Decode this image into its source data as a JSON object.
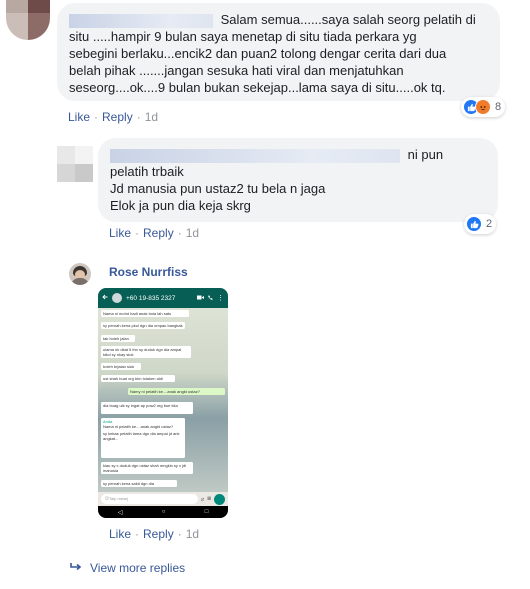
{
  "comments": [
    {
      "text_lines": [
        "Salam semua......saya salah seorg pelatih di",
        "situ .....hampir 9 bulan saya menetap di situ tiada perkara yg",
        "sebegini berlaku...encik2 dan puan2 tolong dengar cerita dari dua",
        "belah pihak .......jangan sesuka hati viral dan menjatuhkan",
        "seseorg....ok....9 bulan bukan sekejap...lama saya di situ.....ok tq."
      ],
      "reaction_count": "8",
      "like_label": "Like",
      "reply_label": "Reply",
      "time": "1d"
    },
    {
      "text_lines": [
        "ni pun",
        "pelatih trbaik",
        "Jd manusia pun ustaz2 tu bela n jaga",
        "Elok ja pun dia keja skrg"
      ],
      "reaction_count": "2",
      "like_label": "Like",
      "reply_label": "Reply",
      "time": "1d"
    },
    {
      "author": "Rose Nurrfiss",
      "like_label": "Like",
      "reply_label": "Reply",
      "time": "1d",
      "screenshot": {
        "contact": "+60 19-835 2327",
        "messages": [
          "Nama ni mohd hadi anak bola lah satu",
          "sy pernah kena pkul dgn dia ompau bangkak",
          "tak boleh jalan",
          "ulama nk dkat 5 thn sy duduk dgn dia ampai tdkd sy okay siuk",
          "boleh brjalan siuk",
          "ust shah buat org bkn tolaken aldi",
          "Namy ni pelatih ke....anak angkt ustaz?",
          "dia buag ulk sy ingat ap pow2 org bue kita",
          "Anda",
          "Nama ni pelatih ke....anak angkt ustaz?",
          "sy bekas pelatih lama dgn dia ampai jd ank angkat...",
          "klau sy x duduk dgn ustaz shah mngkin sy x jdi manusia",
          "sy pernah kena sakit dgn dia"
        ],
        "input_placeholder": "Taip mesej"
      }
    }
  ],
  "view_more_label": "View more replies",
  "colors": {
    "link": "#385898",
    "bubble": "#f2f3f5",
    "whatsapp_header": "#075e54",
    "like_blue": "#2078f4",
    "angry_orange": "#f07b2b"
  }
}
